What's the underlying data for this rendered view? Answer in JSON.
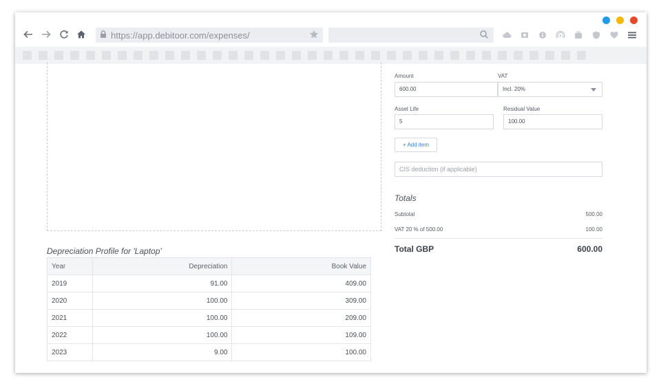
{
  "browser": {
    "url": "https://app.debitoor.com/expenses/",
    "window_dot_colors": [
      "#1e9be9",
      "#f5b800",
      "#e8472a"
    ]
  },
  "icons": {
    "back": "arrow-left-icon",
    "forward": "arrow-right-icon",
    "reload": "reload-icon",
    "home": "home-icon",
    "lock": "lock-icon",
    "bookmark": "star-icon",
    "search": "search-icon",
    "menu": "hamburger-menu-icon"
  },
  "depreciation": {
    "title": "Depreciation Profile for 'Laptop'",
    "columns": [
      "Year",
      "Depreciation",
      "Book Value"
    ],
    "rows": [
      {
        "year": "2019",
        "depreciation": "91.00",
        "book_value": "409.00"
      },
      {
        "year": "2020",
        "depreciation": "100.00",
        "book_value": "309.00"
      },
      {
        "year": "2021",
        "depreciation": "100.00",
        "book_value": "209.00"
      },
      {
        "year": "2022",
        "depreciation": "100.00",
        "book_value": "109.00"
      },
      {
        "year": "2023",
        "depreciation": "9.00",
        "book_value": "100.00"
      }
    ]
  },
  "form": {
    "amount_label": "Amount",
    "amount_value": "600.00",
    "vat_label": "VAT",
    "vat_value": "Incl. 20%",
    "asset_life_label": "Asset Life",
    "asset_life_value": "5",
    "residual_label": "Residual Value",
    "residual_value": "100.00",
    "add_item_label": "+ Add item",
    "cis_placeholder": "CIS deduction (if applicable)"
  },
  "totals": {
    "title": "Totals",
    "subtotal_label": "Subtotal",
    "subtotal_value": "500.00",
    "vat_label": "VAT 20 % of  500.00",
    "vat_value": "100.00",
    "total_label": "Total GBP",
    "total_value": "600.00"
  },
  "colors": {
    "accent": "#3c7fd8"
  }
}
